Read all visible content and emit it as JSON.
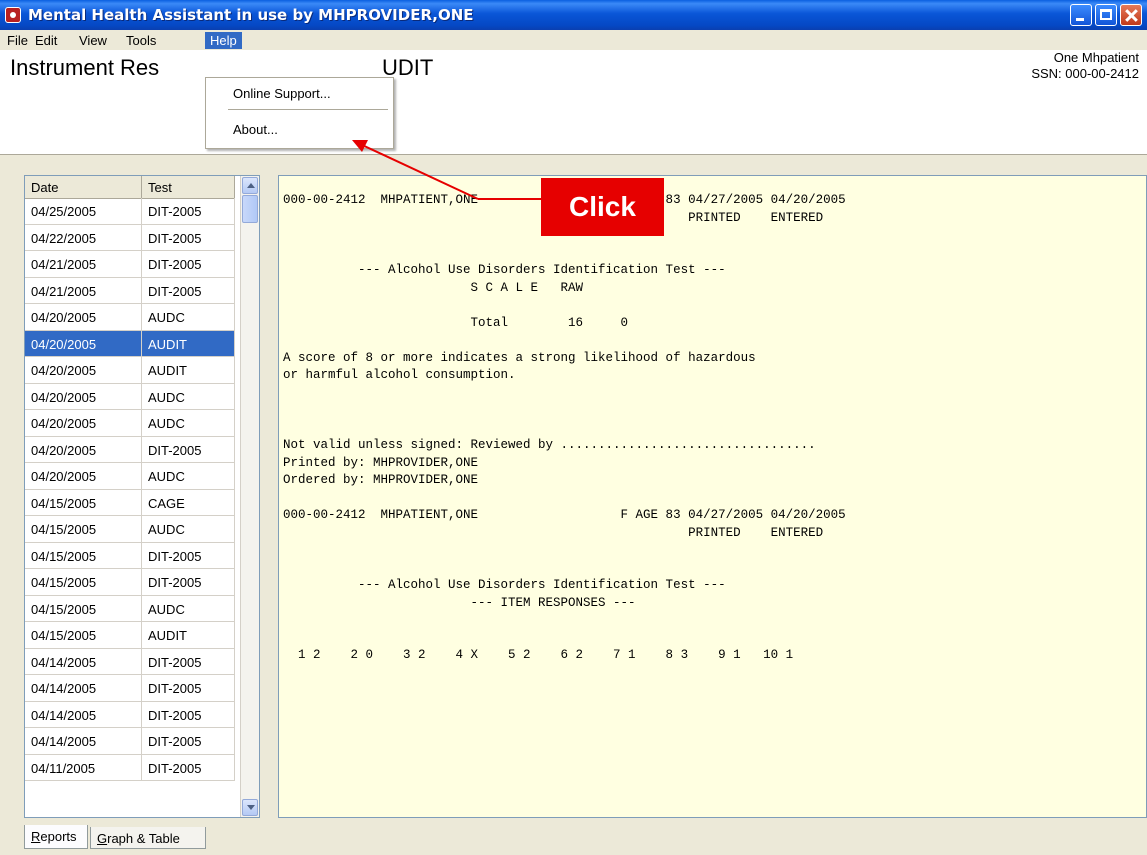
{
  "window": {
    "title": "Mental Health Assistant in use by MHPROVIDER,ONE",
    "icon": "app-icon"
  },
  "menu": [
    "File",
    "Edit",
    "View",
    "Tools",
    "Help"
  ],
  "help_menu": {
    "items": [
      "Online Support...",
      "About..."
    ]
  },
  "header": {
    "title_visible": "Instrument Res",
    "title_tail": "UDIT",
    "patient_name": "One Mhpatient",
    "patient_ssn": "SSN: 000-00-2412"
  },
  "list": {
    "columns": [
      "Date",
      "Test"
    ],
    "rows": [
      [
        "04/25/2005",
        "DIT-2005"
      ],
      [
        "04/22/2005",
        "DIT-2005"
      ],
      [
        "04/21/2005",
        "DIT-2005"
      ],
      [
        "04/21/2005",
        "DIT-2005"
      ],
      [
        "04/20/2005",
        "AUDC"
      ],
      [
        "04/20/2005",
        "AUDIT"
      ],
      [
        "04/20/2005",
        "AUDIT"
      ],
      [
        "04/20/2005",
        "AUDC"
      ],
      [
        "04/20/2005",
        "AUDC"
      ],
      [
        "04/20/2005",
        "DIT-2005"
      ],
      [
        "04/20/2005",
        "AUDC"
      ],
      [
        "04/15/2005",
        "CAGE"
      ],
      [
        "04/15/2005",
        "AUDC"
      ],
      [
        "04/15/2005",
        "DIT-2005"
      ],
      [
        "04/15/2005",
        "DIT-2005"
      ],
      [
        "04/15/2005",
        "AUDC"
      ],
      [
        "04/15/2005",
        "AUDIT"
      ],
      [
        "04/14/2005",
        "DIT-2005"
      ],
      [
        "04/14/2005",
        "DIT-2005"
      ],
      [
        "04/14/2005",
        "DIT-2005"
      ],
      [
        "04/14/2005",
        "DIT-2005"
      ],
      [
        "04/11/2005",
        "DIT-2005"
      ]
    ],
    "selected_index": 5
  },
  "report": {
    "lines": [
      "000-00-2412  MHPATIENT,ONE                   F AGE 83 04/27/2005 04/20/2005",
      "                                                      PRINTED    ENTERED",
      "",
      "",
      "          --- Alcohol Use Disorders Identification Test ---",
      "                         S C A L E   RAW",
      "",
      "                         Total        16     0",
      "",
      "A score of 8 or more indicates a strong likelihood of hazardous",
      "or harmful alcohol consumption.",
      "",
      "",
      "",
      "Not valid unless signed: Reviewed by ..................................",
      "Printed by: MHPROVIDER,ONE",
      "Ordered by: MHPROVIDER,ONE",
      "",
      "000-00-2412  MHPATIENT,ONE                   F AGE 83 04/27/2005 04/20/2005",
      "                                                      PRINTED    ENTERED",
      "",
      "",
      "          --- Alcohol Use Disorders Identification Test ---",
      "                         --- ITEM RESPONSES ---",
      "",
      "",
      "  1 2    2 0    3 2    4 X    5 2    6 2    7 1    8 3    9 1   10 1"
    ]
  },
  "tabs": [
    {
      "label_first": "R",
      "label_rest": "eports"
    },
    {
      "label_first": "G",
      "label_rest": "raph & Table"
    }
  ],
  "annotation": {
    "label": "Click",
    "color": "#e60000"
  },
  "colors": {
    "selection": "#316ac5",
    "report_bg": "#ffffe1",
    "titlebar": "#0a56d8"
  }
}
